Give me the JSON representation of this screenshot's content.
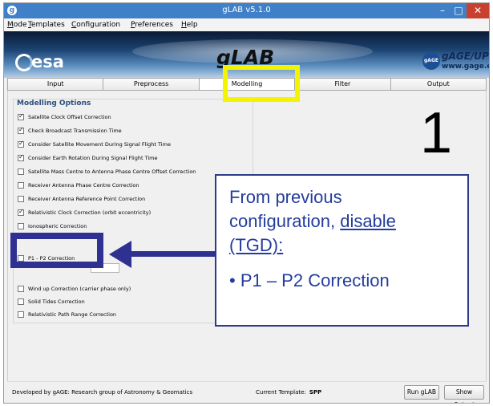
{
  "window": {
    "title": "gLAB v5.1.0",
    "icon": "glab-app-icon",
    "controls": {
      "minimize": "–",
      "maximize": "□",
      "close": "✕"
    }
  },
  "menu": [
    "Mode",
    "Templates",
    "Configuration",
    "Preferences",
    "Help"
  ],
  "banner": {
    "left_logo": "esa",
    "center_logo": "gLAB",
    "right_logo_top": "gAGE/UPC",
    "right_logo_bottom": "www.gage.es",
    "right_logo_mark": "gAGE"
  },
  "tabs": [
    {
      "label": "Input",
      "active": false
    },
    {
      "label": "Preprocess",
      "active": false
    },
    {
      "label": "Modelling",
      "active": true
    },
    {
      "label": "Filter",
      "active": false
    },
    {
      "label": "Output",
      "active": false
    }
  ],
  "modelling": {
    "section_title": "Modelling Options",
    "options": [
      {
        "label": "Satellite Clock Offset Correction",
        "checked": true
      },
      {
        "label": "Check Broadcast Transmission Time",
        "checked": true
      },
      {
        "label": "Consider Satellite Movement During Signal Flight Time",
        "checked": true
      },
      {
        "label": "Consider Earth Rotation During Signal Flight Time",
        "checked": true
      },
      {
        "label": "Satellite Mass Centre to Antenna Phase Centre Offset Correction",
        "checked": false
      },
      {
        "label": "Receiver Antenna Phase Centre Correction",
        "checked": false
      },
      {
        "label": "Receiver Antenna Reference Point Correction",
        "checked": false
      },
      {
        "label": "Relativistic Clock Correction (orbit eccentricity)",
        "checked": true
      },
      {
        "label": "Ionospheric Correction",
        "checked": false
      },
      {
        "label": "P1 - P2 Correction",
        "checked": false
      },
      {
        "label": "Wind up Correction (carrier phase only)",
        "checked": false
      },
      {
        "label": "Solid Tides Correction",
        "checked": false
      },
      {
        "label": "Relativistic Path Range Correction",
        "checked": false
      }
    ]
  },
  "status": {
    "developer_text": "Developed by gAGE: Research group of Astronomy & Geomatics",
    "template_label": "Current Template:",
    "template_value": "SPP",
    "run_label": "Run gLAB",
    "show_label": "Show Output"
  },
  "annotation": {
    "step_number": "1",
    "line1": "From previous",
    "line2a": "configuration, ",
    "line2b": "disable",
    "line3": "(TGD):",
    "bullet": "• P1 – P2 Correction",
    "highlight_color": "#f4f300",
    "accent_color": "#2e3191"
  }
}
